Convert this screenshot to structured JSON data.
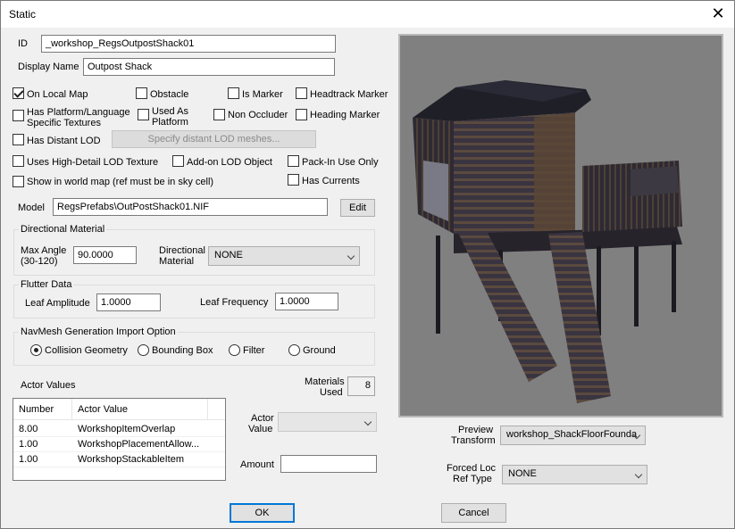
{
  "window": {
    "title": "Static",
    "close_glyph": "✕"
  },
  "form": {
    "id_label": "ID",
    "id_value": "_workshop_RegsOutpostShack01",
    "display_name_label": "Display Name",
    "display_name_value": "Outpost Shack"
  },
  "checkboxes": {
    "on_local_map": {
      "label": "On Local Map",
      "checked": true
    },
    "obstacle": {
      "label": "Obstacle",
      "checked": false
    },
    "is_marker": {
      "label": "Is Marker",
      "checked": false
    },
    "headtrack_marker": {
      "label": "Headtrack Marker",
      "checked": false
    },
    "platform_textures": {
      "label_line1": "Has Platform/Language",
      "label_line2": "Specific Textures",
      "checked": false
    },
    "used_as_platform": {
      "label_line1": "Used As",
      "label_line2": "Platform",
      "checked": false
    },
    "non_occluder": {
      "label": "Non Occluder",
      "checked": false
    },
    "heading_marker": {
      "label": "Heading Marker",
      "checked": false
    },
    "distant_lod": {
      "label": "Has Distant LOD",
      "checked": false
    },
    "high_detail_lod": {
      "label": "Uses High-Detail LOD Texture",
      "checked": false
    },
    "addon_lod": {
      "label": "Add-on LOD Object",
      "checked": false
    },
    "pack_in": {
      "label": "Pack-In Use Only",
      "checked": false
    },
    "world_map": {
      "label": "Show in world map (ref must be in sky cell)",
      "checked": false
    },
    "has_currents": {
      "label": "Has Currents",
      "checked": false
    }
  },
  "lod_button": {
    "label": "Specify distant LOD meshes..."
  },
  "model": {
    "label": "Model",
    "value": "RegsPrefabs\\OutPostShack01.NIF",
    "edit_label": "Edit"
  },
  "directional_material": {
    "group_title": "Directional Material",
    "max_angle_label_1": "Max Angle",
    "max_angle_label_2": "(30-120)",
    "max_angle_value": "90.0000",
    "dir_label_1": "Directional",
    "dir_label_2": "Material",
    "dir_value": "NONE"
  },
  "flutter": {
    "group_title": "Flutter Data",
    "amplitude_label": "Leaf Amplitude",
    "amplitude_value": "1.0000",
    "frequency_label": "Leaf Frequency",
    "frequency_value": "1.0000"
  },
  "navmesh": {
    "group_title": "NavMesh Generation Import Option",
    "options": [
      {
        "label": "Collision Geometry",
        "checked": true
      },
      {
        "label": "Bounding Box",
        "checked": false
      },
      {
        "label": "Filter",
        "checked": false
      },
      {
        "label": "Ground",
        "checked": false
      }
    ]
  },
  "actor_values": {
    "label": "Actor Values",
    "columns": [
      "Number",
      "Actor Value"
    ],
    "rows": [
      {
        "number": "8.00",
        "value": "WorkshopItemOverlap"
      },
      {
        "number": "1.00",
        "value": "WorkshopPlacementAllow..."
      },
      {
        "number": "1.00",
        "value": "WorkshopStackableItem"
      }
    ],
    "actor_value_label_1": "Actor",
    "actor_value_label_2": "Value",
    "actor_value_selected": "",
    "amount_label": "Amount",
    "amount_value": ""
  },
  "materials": {
    "label_1": "Materials",
    "label_2": "Used",
    "value": "8"
  },
  "preview": {
    "transform_label_1": "Preview",
    "transform_label_2": "Transform",
    "transform_value": "workshop_ShackFloorFounda",
    "forced_loc_label_1": "Forced Loc",
    "forced_loc_label_2": "Ref Type",
    "forced_loc_value": "NONE"
  },
  "buttons": {
    "ok": "OK",
    "cancel": "Cancel"
  },
  "colors": {
    "accent": "#0078d7",
    "viewport_bg": "#808080",
    "wood_dark": "#2f2d33",
    "wood_mid": "#4d4038"
  }
}
